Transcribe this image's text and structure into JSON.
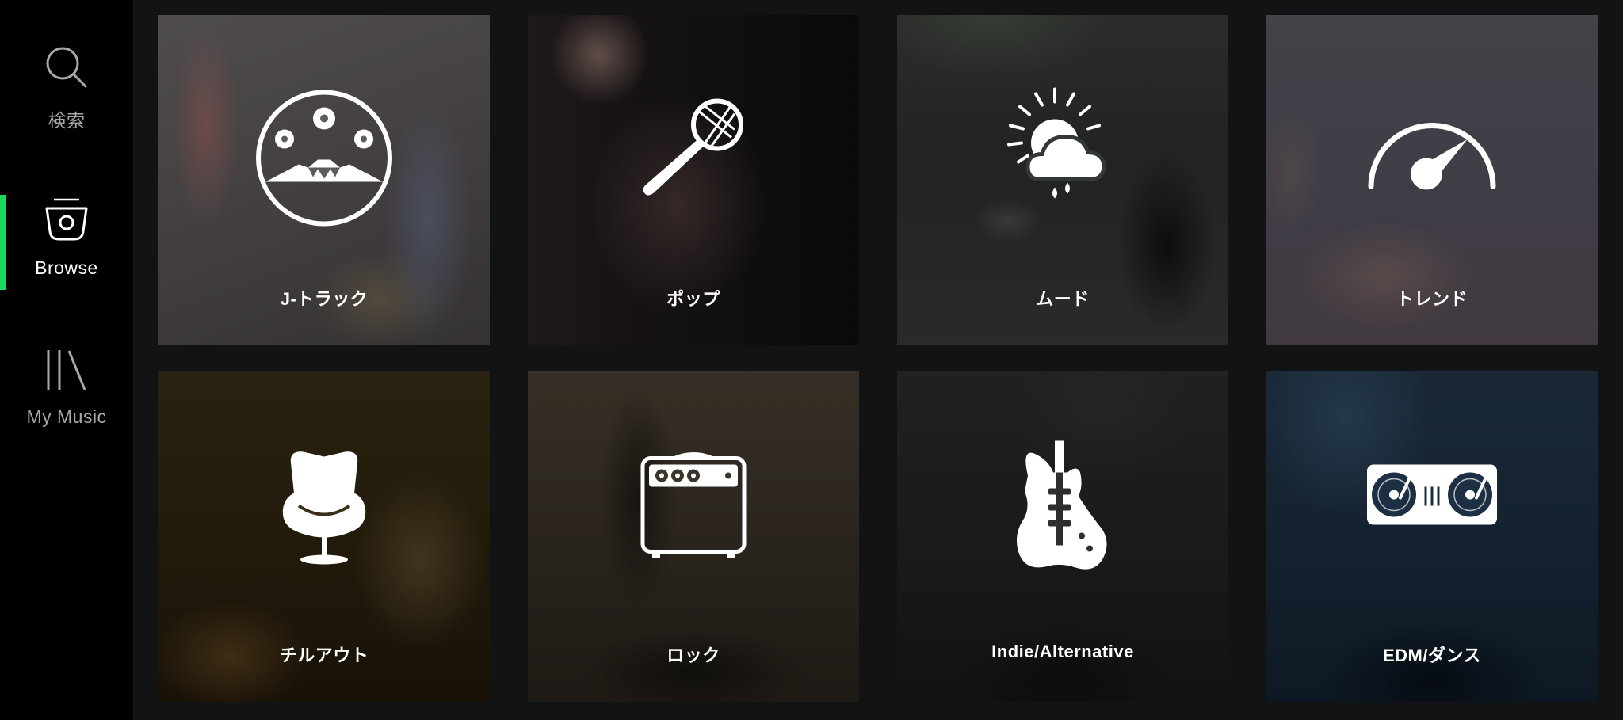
{
  "sidebar": {
    "items": [
      {
        "label": "検索",
        "icon": "search-icon",
        "active": false
      },
      {
        "label": "Browse",
        "icon": "radio-icon",
        "active": true
      },
      {
        "label": "My Music",
        "icon": "library-icon",
        "active": false
      }
    ],
    "accent": "#1ed760"
  },
  "tiles": [
    {
      "label": "J-トラック",
      "icon": "mount-fuji-icon"
    },
    {
      "label": "ポップ",
      "icon": "microphone-icon"
    },
    {
      "label": "ムード",
      "icon": "weather-icon"
    },
    {
      "label": "トレンド",
      "icon": "speedometer-icon"
    },
    {
      "label": "チルアウト",
      "icon": "egg-chair-icon"
    },
    {
      "label": "ロック",
      "icon": "amplifier-icon"
    },
    {
      "label": "Indie/Alternative",
      "icon": "electric-guitar-icon"
    },
    {
      "label": "EDM/ダンス",
      "icon": "turntables-icon"
    }
  ]
}
